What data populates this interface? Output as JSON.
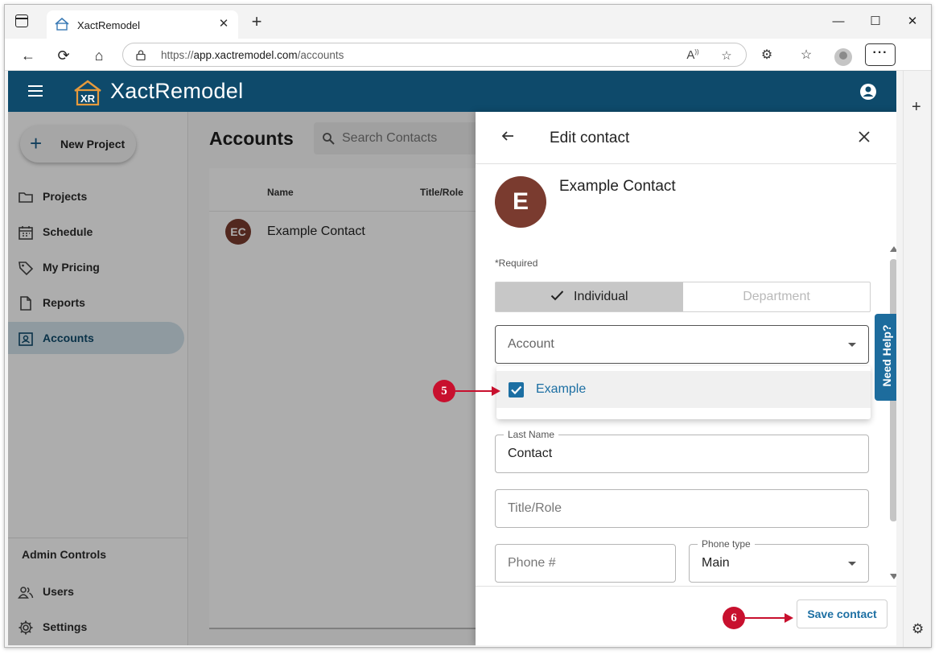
{
  "browser": {
    "tab_title": "XactRemodel",
    "url_prefix": "https://",
    "url_host": "app.xactremodel.com",
    "url_path": "/accounts"
  },
  "app": {
    "brand": "XactRemodel",
    "logo_text": "XR"
  },
  "sidebar": {
    "new_project_label": "New Project",
    "items": [
      {
        "label": "Projects",
        "icon": "folder-icon"
      },
      {
        "label": "Schedule",
        "icon": "calendar-icon"
      },
      {
        "label": "My Pricing",
        "icon": "tag-icon"
      },
      {
        "label": "Reports",
        "icon": "document-icon"
      },
      {
        "label": "Accounts",
        "icon": "contact-card-icon",
        "active": true
      }
    ],
    "admin_heading": "Admin Controls",
    "admin_items": [
      {
        "label": "Users",
        "icon": "users-icon"
      },
      {
        "label": "Settings",
        "icon": "gear-icon"
      }
    ]
  },
  "main": {
    "title": "Accounts",
    "search_placeholder": "Search Contacts",
    "columns": [
      "Name",
      "Title/Role"
    ],
    "rows": [
      {
        "initials": "EC",
        "name": "Example Contact"
      }
    ]
  },
  "panel": {
    "title": "Edit contact",
    "avatar_letter": "E",
    "contact_name": "Example Contact",
    "required_note": "*Required",
    "toggle_selected": "Individual",
    "toggle_other": "Department",
    "account_placeholder": "Account",
    "dropdown_option": "Example",
    "last_name_label": "Last Name",
    "last_name_value": "Contact",
    "title_role_placeholder": "Title/Role",
    "phone_placeholder": "Phone #",
    "phone_type_label": "Phone type",
    "phone_type_value": "Main",
    "save_label": "Save contact"
  },
  "help_tab": "Need Help?",
  "callouts": [
    "5",
    "6"
  ],
  "colors": {
    "appbar": "#0e4a6b",
    "accent": "#1c6fa3",
    "avatar": "#7a3b2f",
    "callout": "#c8102e"
  }
}
